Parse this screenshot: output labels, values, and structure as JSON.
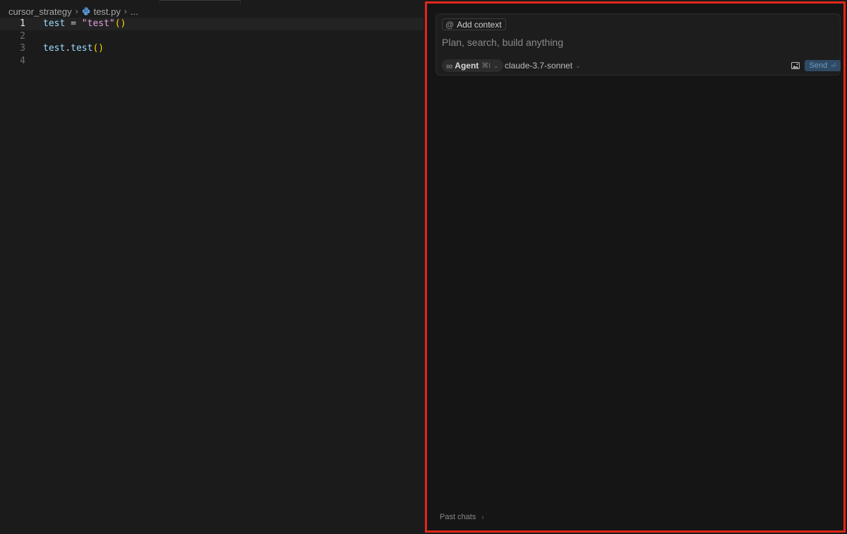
{
  "breadcrumb": {
    "folder": "cursor_strategy",
    "file": "test.py",
    "more": "..."
  },
  "editor": {
    "line_numbers": [
      "1",
      "2",
      "3",
      "4"
    ],
    "line1": {
      "var": "test",
      "op": " = ",
      "str": "\"test\"",
      "parens": "()"
    },
    "line3": {
      "obj": "test",
      "dot": ".",
      "method": "test",
      "parens": "()"
    }
  },
  "chat": {
    "add_context": "Add context",
    "at_symbol": "@",
    "placeholder": "Plan, search, build anything",
    "mode": {
      "icon": "∞",
      "label": "Agent",
      "shortcut": "⌘I"
    },
    "model": "claude-3.7-sonnet",
    "send_label": "Send",
    "send_shortcut": "⏎",
    "past_chats": "Past chats"
  },
  "colors": {
    "highlight_border": "#e0271b",
    "send_bg": "#2f4a64",
    "background": "#1b1b1b"
  }
}
